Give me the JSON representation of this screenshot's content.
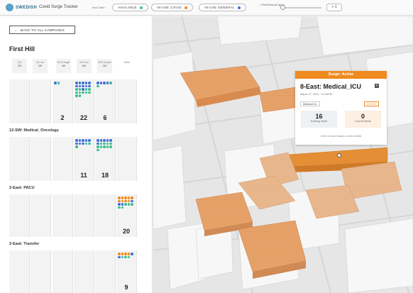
{
  "header": {
    "logo_text": "SWEDISH",
    "app_title": "Covid Surge Tracker",
    "bed_state_label": "Bed State",
    "filters": [
      {
        "label": "AVAILABLE",
        "dot": "#3dbf8e"
      },
      {
        "label": "IN-USE COVID",
        "dot": "#ef8a1f"
      },
      {
        "label": "IN-USE GENERAL",
        "dot": "#3f6fd8"
      }
    ],
    "slider_label": "# Staff Beds (all types)",
    "slider_value": "> 1"
  },
  "sidebar": {
    "back_label": "BACK TO ALL CAMPUSES",
    "campus": "First Hill",
    "columns": [
      {
        "name": "ICU",
        "sub": "Diff"
      },
      {
        "name": "ICU Iso",
        "sub": "Diff"
      },
      {
        "name": "NCS Single",
        "sub": "Diff"
      },
      {
        "name": "NCS Iso",
        "sub": "Diff"
      },
      {
        "name": "NCS Double",
        "sub": "Diff"
      },
      {
        "name": "Other",
        "sub": ""
      }
    ],
    "units": [
      {
        "label": "",
        "counts": [
          "",
          "",
          "2",
          "22",
          "6",
          ""
        ]
      },
      {
        "label": "12-SW: Medical_Oncology",
        "counts": [
          "",
          "",
          "11",
          "18",
          "",
          ""
        ]
      },
      {
        "label": "2-East: PACU",
        "counts": [
          "",
          "",
          "",
          "",
          "",
          "20"
        ]
      },
      {
        "label": "2-East: Transfer",
        "counts": [
          "",
          "",
          "",
          "",
          "",
          "9"
        ]
      }
    ]
  },
  "popup": {
    "status": "Surge: Active",
    "title": "8-East: Medical_ICU",
    "date": "March 27, 2020  ·  12:34PM",
    "tag_left": "Medical ICU",
    "tag_right": "COVID+",
    "existing_num": "16",
    "existing_label": "Existing Beds",
    "existing_color": "#eef1f4",
    "current_num": "0",
    "current_label": "Current Beds",
    "current_color": "#fdefe2",
    "hint": "Click on ward shapes to view details"
  },
  "colors": {
    "accent": "#ef8a1f",
    "available": "#3dbf8e",
    "general": "#3f6fd8"
  }
}
